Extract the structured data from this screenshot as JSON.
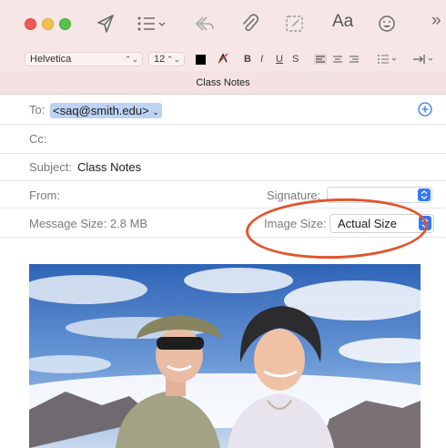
{
  "toolbar": {
    "icons": [
      "send-icon",
      "header-fields-icon",
      "reply-icon",
      "attachment-icon",
      "markup-icon",
      "format-icon",
      "emoji-icon",
      "more-icon"
    ],
    "format_label": "Aa",
    "more_label": "»"
  },
  "format_bar": {
    "font": "Helvetica",
    "size": "12",
    "bold": "B",
    "italic": "I",
    "underline": "U",
    "strike": "S"
  },
  "window": {
    "title": "Class Notes"
  },
  "fields": {
    "to_label": "To:",
    "to_value": "<saq@smith.edu>",
    "cc_label": "Cc:",
    "subject_label": "Subject:",
    "subject_value": "Class Notes",
    "from_label": "From:",
    "signature_label": "Signature:",
    "message_size_label": "Message Size:",
    "message_size_value": "2.8 MB",
    "image_size_label": "Image Size:",
    "image_size_value": "Actual Size"
  },
  "colors": {
    "toolbar_bg": "#f6e7e6",
    "accent": "#3478f6",
    "highlight_ring": "#e0552e",
    "recipient_token": "#bcd3f3"
  }
}
